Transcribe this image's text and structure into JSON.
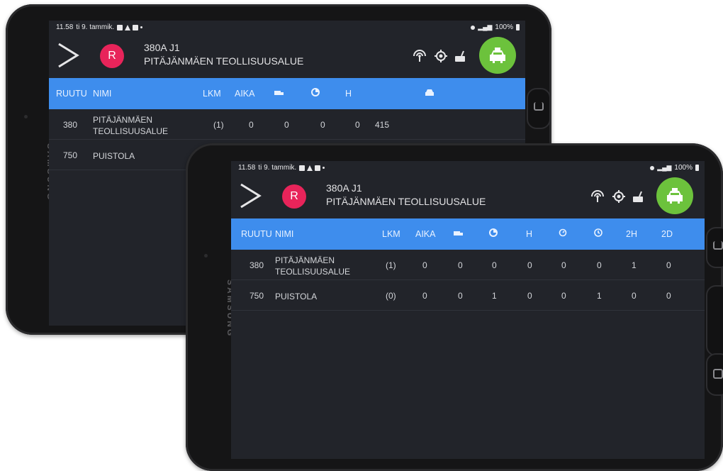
{
  "back": {
    "status": {
      "time": "11.58",
      "date": "ti 9. tammik.",
      "battery": "100%"
    },
    "header": {
      "avatar_letter": "R",
      "route_code": "380A J1",
      "route_name": "PITÄJÄNMÄEN TEOLLISUUSALUE"
    },
    "brand": "SAMSUNG",
    "columns": [
      "RUUTU",
      "NIMI",
      "LKM",
      "AIKA",
      "truck-icon",
      "pie-icon",
      "H",
      "car-icon"
    ],
    "rows": [
      {
        "ruutu": "380",
        "nimi_1": "PITÄJÄNMÄEN",
        "nimi_2": "TEOLLISUUSALUE",
        "lkm": "(1)",
        "aika": "0",
        "c3": "0",
        "c4": "0",
        "h": "0",
        "c6": "415"
      },
      {
        "ruutu": "750",
        "nimi_1": "PUISTOLA"
      }
    ]
  },
  "front": {
    "status": {
      "time": "11.58",
      "date": "ti 9. tammik.",
      "battery": "100%"
    },
    "header": {
      "avatar_letter": "R",
      "route_code": "380A J1",
      "route_name": "PITÄJÄNMÄEN TEOLLISUUSALUE"
    },
    "brand": "SAMSUNG",
    "columns": {
      "ruutu": "RUUTU",
      "nimi": "NIMI",
      "lkm": "LKM",
      "aika": "AIKA",
      "truck": "truck-icon",
      "pie": "pie-icon",
      "h": "H",
      "timer": "timer-icon",
      "clock": "clock-icon",
      "h2": "2H",
      "d2": "2D"
    },
    "rows": [
      {
        "ruutu": "380",
        "nimi_1": "PITÄJÄNMÄEN",
        "nimi_2": "TEOLLISUUSALUE",
        "lkm": "(1)",
        "aika": "0",
        "truck": "0",
        "pie": "0",
        "h": "0",
        "timer": "0",
        "clock": "0",
        "h2": "1",
        "d2": "0"
      },
      {
        "ruutu": "750",
        "nimi_1": "PUISTOLA",
        "lkm": "(0)",
        "aika": "0",
        "truck": "0",
        "pie": "1",
        "h": "0",
        "timer": "0",
        "clock": "1",
        "h2": "0",
        "d2": "0"
      }
    ]
  },
  "colors": {
    "accent_blue": "#3e8ded",
    "taxi_green": "#6cc23c",
    "avatar_pink": "#e8245a",
    "screen_bg": "#22242a"
  }
}
